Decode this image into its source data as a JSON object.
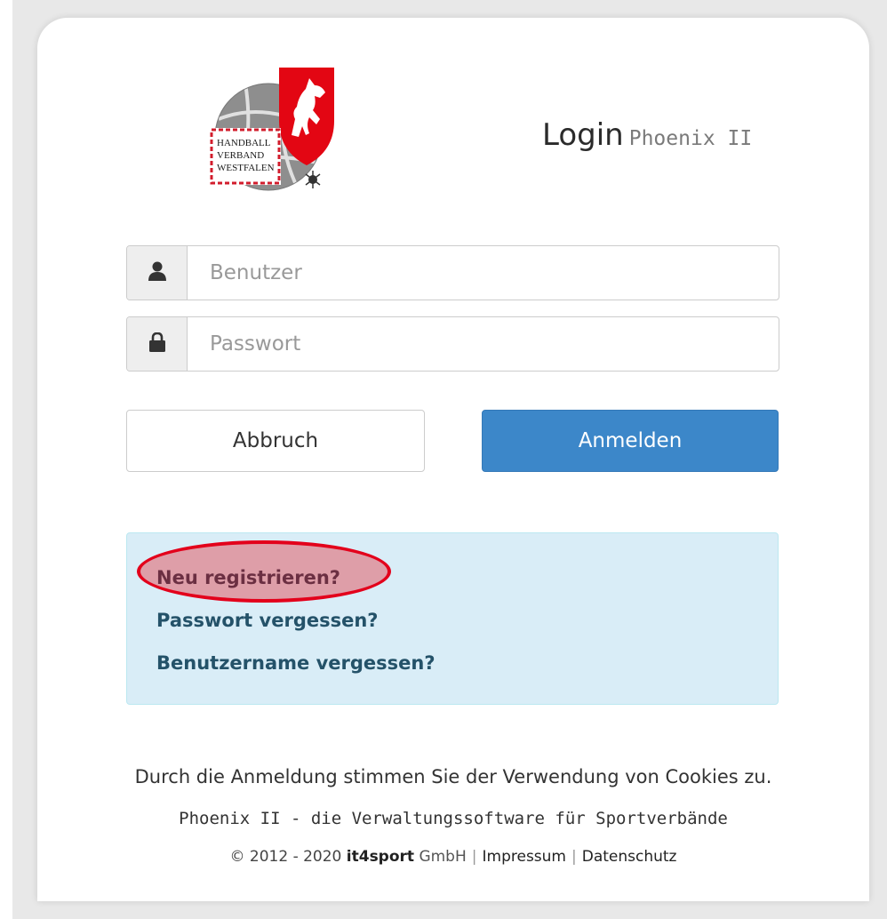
{
  "header": {
    "title": "Login",
    "subtitle": "Phoenix II",
    "logo_lines": [
      "HANDBALL",
      "VERBAND",
      "WESTFALEN"
    ]
  },
  "form": {
    "username": {
      "placeholder": "Benutzer",
      "value": "",
      "icon": "user-icon"
    },
    "password": {
      "placeholder": "Passwort",
      "value": "",
      "icon": "lock-icon"
    },
    "cancel_label": "Abbruch",
    "login_label": "Anmelden"
  },
  "links": {
    "register": "Neu registrieren?",
    "forgot_password": "Passwort vergessen?",
    "forgot_username": "Benutzername vergessen?"
  },
  "footer": {
    "cookie_notice": "Durch die Anmeldung stimmen Sie der Verwendung von Cookies zu.",
    "tagline": "Phoenix II - die Verwaltungssoftware für Sportverbände",
    "copyright": "© 2012 - 2020",
    "company_name": "it4sport",
    "company_suffix": "GmbH",
    "imprint": "Impressum",
    "privacy": "Datenschutz"
  },
  "colors": {
    "primary_button": "#3c87c9",
    "info_background": "#d9edf7",
    "link_color": "#245269",
    "highlight_red": "#e3001b"
  }
}
